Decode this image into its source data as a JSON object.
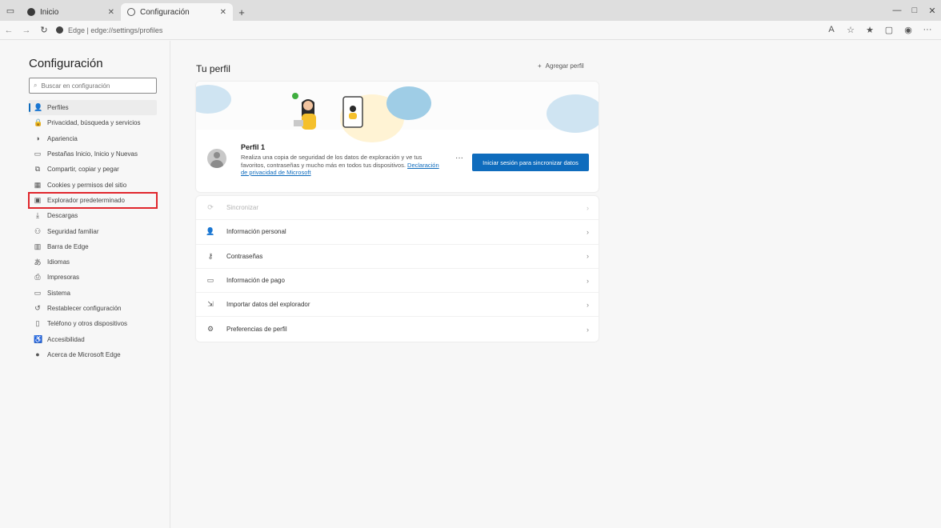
{
  "browser": {
    "tabs": [
      {
        "title": "Inicio",
        "active": false
      },
      {
        "title": "Configuración",
        "active": true
      }
    ],
    "new_tab_glyph": "+",
    "address": "Edge | edge://settings/profiles",
    "window_controls": [
      "—",
      "□",
      "✕"
    ]
  },
  "sidebar": {
    "title": "Configuración",
    "search_placeholder": "Buscar en configuración",
    "items": [
      {
        "label": "Perfiles",
        "icon": "profile-icon",
        "glyph": "👤"
      },
      {
        "label": "Privacidad, búsqueda y servicios",
        "icon": "lock-icon",
        "glyph": "🔒"
      },
      {
        "label": "Apariencia",
        "icon": "appearance-icon",
        "glyph": "◑"
      },
      {
        "label": "Pestañas Inicio, Inicio y Nuevas",
        "icon": "tabs-icon",
        "glyph": "▭"
      },
      {
        "label": "Compartir, copiar y pegar",
        "icon": "share-icon",
        "glyph": "⧉"
      },
      {
        "label": "Cookies y permisos del sitio",
        "icon": "cookie-icon",
        "glyph": "▦"
      },
      {
        "label": "Explorador predeterminado",
        "icon": "default-browser-icon",
        "glyph": "▣"
      },
      {
        "label": "Descargas",
        "icon": "download-icon",
        "glyph": "⤓"
      },
      {
        "label": "Seguridad familiar",
        "icon": "family-icon",
        "glyph": "⚇"
      },
      {
        "label": "Barra de Edge",
        "icon": "edge-bar-icon",
        "glyph": "▥"
      },
      {
        "label": "Idiomas",
        "icon": "language-icon",
        "glyph": "あ"
      },
      {
        "label": "Impresoras",
        "icon": "printer-icon",
        "glyph": "⎙"
      },
      {
        "label": "Sistema",
        "icon": "system-icon",
        "glyph": "▭"
      },
      {
        "label": "Restablecer configuración",
        "icon": "reset-icon",
        "glyph": "↺"
      },
      {
        "label": "Teléfono y otros dispositivos",
        "icon": "phone-icon",
        "glyph": "▯"
      },
      {
        "label": "Accesibilidad",
        "icon": "accessibility-icon",
        "glyph": "♿"
      },
      {
        "label": "Acerca de Microsoft Edge",
        "icon": "edge-logo-icon",
        "glyph": "●"
      }
    ]
  },
  "main": {
    "title": "Tu perfil",
    "add_profile": "Agregar perfil",
    "profile": {
      "name": "Perfil 1",
      "desc": "Realiza una copia de seguridad de los datos de exploración y ve tus favoritos, contraseñas y mucho más en todos tus dispositivos.",
      "link": "Declaración de privacidad de Microsoft",
      "more": "···",
      "sync_button": "Iniciar sesión para sincronizar datos"
    },
    "rows": [
      {
        "label": "Sincronizar",
        "icon": "sync-icon",
        "glyph": "⟳",
        "disabled": true
      },
      {
        "label": "Información personal",
        "icon": "personal-info-icon",
        "glyph": "👤",
        "disabled": false
      },
      {
        "label": "Contraseñas",
        "icon": "key-icon",
        "glyph": "⚷",
        "disabled": false
      },
      {
        "label": "Información de pago",
        "icon": "card-icon",
        "glyph": "▭",
        "disabled": false
      },
      {
        "label": "Importar datos del explorador",
        "icon": "import-icon",
        "glyph": "⇲",
        "disabled": false
      },
      {
        "label": "Preferencias de perfil",
        "icon": "profile-prefs-icon",
        "glyph": "⚙",
        "disabled": false
      }
    ]
  },
  "colors": {
    "accent": "#0f6cbd",
    "highlight": "#e0262c"
  }
}
